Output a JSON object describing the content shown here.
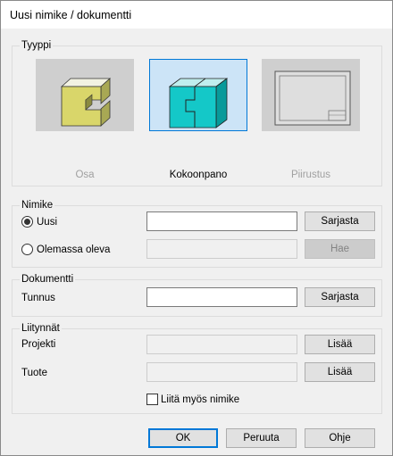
{
  "window": {
    "title": "Uusi nimike / dokumentti"
  },
  "type_group": {
    "title": "Tyyppi",
    "options": [
      {
        "label": "Osa",
        "icon": "part-icon",
        "state": "disabled"
      },
      {
        "label": "Kokoonpano",
        "icon": "assembly-icon",
        "state": "selected"
      },
      {
        "label": "Piirustus",
        "icon": "drawing-icon",
        "state": "disabled"
      }
    ]
  },
  "item_group": {
    "title": "Nimike",
    "new_radio": {
      "label": "Uusi",
      "checked": true
    },
    "new_value": "",
    "series_button": "Sarjasta",
    "existing_radio": {
      "label": "Olemassa oleva",
      "checked": false
    },
    "existing_value": "",
    "search_button": "Hae"
  },
  "document_group": {
    "title": "Dokumentti",
    "id_label": "Tunnus",
    "id_value": "",
    "series_button": "Sarjasta"
  },
  "attachments_group": {
    "title": "Liitynnät",
    "project_label": "Projekti",
    "project_value": "",
    "project_add": "Lisää",
    "product_label": "Tuote",
    "product_value": "",
    "product_add": "Lisää",
    "attach_item_label": "Liitä myös nimike",
    "attach_item_checked": false
  },
  "footer": {
    "ok": "OK",
    "cancel": "Peruuta",
    "help": "Ohje"
  }
}
